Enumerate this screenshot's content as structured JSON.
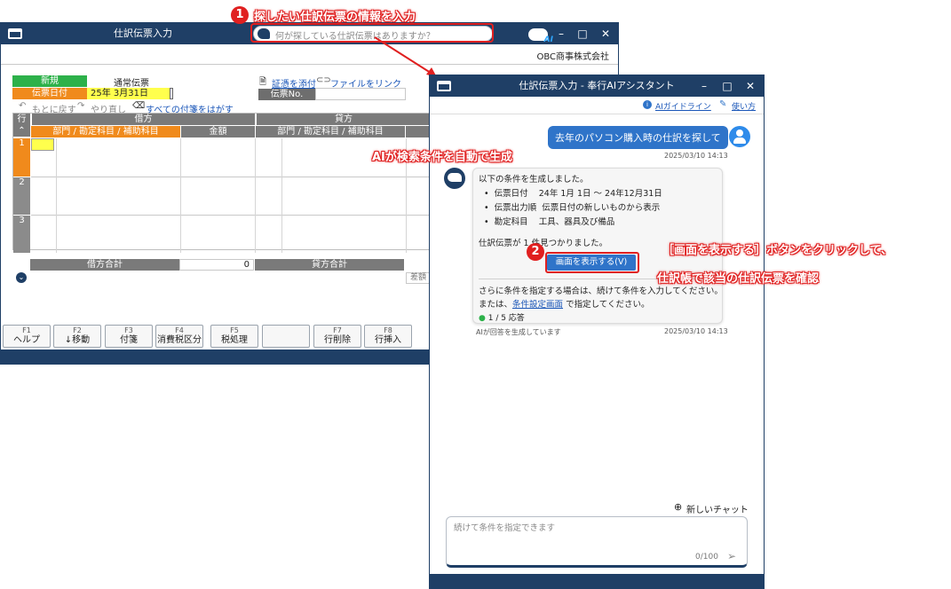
{
  "main": {
    "title": "仕訳伝票入力",
    "search_placeholder": "何が探している仕訳伝票はありますか？",
    "company": "OBC商事株式会社",
    "new_label": "新規",
    "doc_type": "通常伝票",
    "date_label": "伝票日付",
    "date_value": "25年  3月31日",
    "attach_label": "証憑を添付",
    "link_label": "ファイルをリンク",
    "voucher_no_label": "伝票No.",
    "undo": "もとに戻す",
    "redo": "やり直し",
    "remove_tags": "すべての付箋をはがす",
    "grid": {
      "row_label": "行",
      "debit": "借方",
      "credit": "貸方",
      "account_col": "部門 / 勘定科目 / 補助科目",
      "amount_col": "金額",
      "rows": [
        "1",
        "2",
        "3"
      ],
      "debit_total_label": "借方合計",
      "debit_total_value": "0",
      "credit_total_label": "貸方合計",
      "diff_label": "差額"
    },
    "fkeys": [
      {
        "key": "F1",
        "name": "ヘルプ"
      },
      {
        "key": "F2",
        "name": "↓移動"
      },
      {
        "key": "F3",
        "name": "付箋"
      },
      {
        "key": "F4",
        "name": "消費税区分"
      },
      {
        "key": "F5",
        "name": "税処理"
      },
      {
        "key": "",
        "name": ""
      },
      {
        "key": "F7",
        "name": "行削除"
      },
      {
        "key": "F8",
        "name": "行挿入"
      }
    ]
  },
  "ai": {
    "title": "仕訳伝票入力 - 奉行AIアシスタント",
    "guideline_link": "AIガイドライン",
    "howto_link": "使い方",
    "user_message": "去年のパソコン購入時の仕訳を探して",
    "user_time": "2025/03/10 14:13",
    "reply_intro": "以下の条件を生成しました。",
    "conditions": [
      {
        "name": "伝票日付",
        "value": "24年 1月 1日 ～ 24年12月31日"
      },
      {
        "name": "伝票出力順",
        "value": "伝票日付の新しいものから表示"
      },
      {
        "name": "勘定科目",
        "value": "工具、器具及び備品"
      }
    ],
    "found": "仕訳伝票が 1 件見つかりました。",
    "show_button": "画面を表示する(V)",
    "more1": "さらに条件を指定する場合は、続けて条件を入力してください。",
    "more2_pre": "または、",
    "more2_link": "条件設定画面",
    "more2_post": "で指定してください。",
    "count": "1 / 5 応答",
    "ai_note": "AIが回答を生成しています",
    "ai_time": "2025/03/10 14:13",
    "new_chat": "新しいチャット",
    "input_placeholder": "続けて条件を指定できます",
    "char_count": "0/100"
  },
  "annotations": {
    "step1_num": "1",
    "step1": "探したい仕訳伝票の情報を入力",
    "ai_gen": "AIが検索条件を自動で生成",
    "step2_num": "2",
    "step2_line1": "［画面を表示する］ボタンをクリックして、",
    "step2_line2": "仕訳帳で該当の仕訳伝票を確認"
  },
  "colors": {
    "titlebar": "#1f3f66",
    "accent": "#2f74c9",
    "annotation": "#e02020",
    "orange": "#f08a1c",
    "green": "#2db14a"
  }
}
